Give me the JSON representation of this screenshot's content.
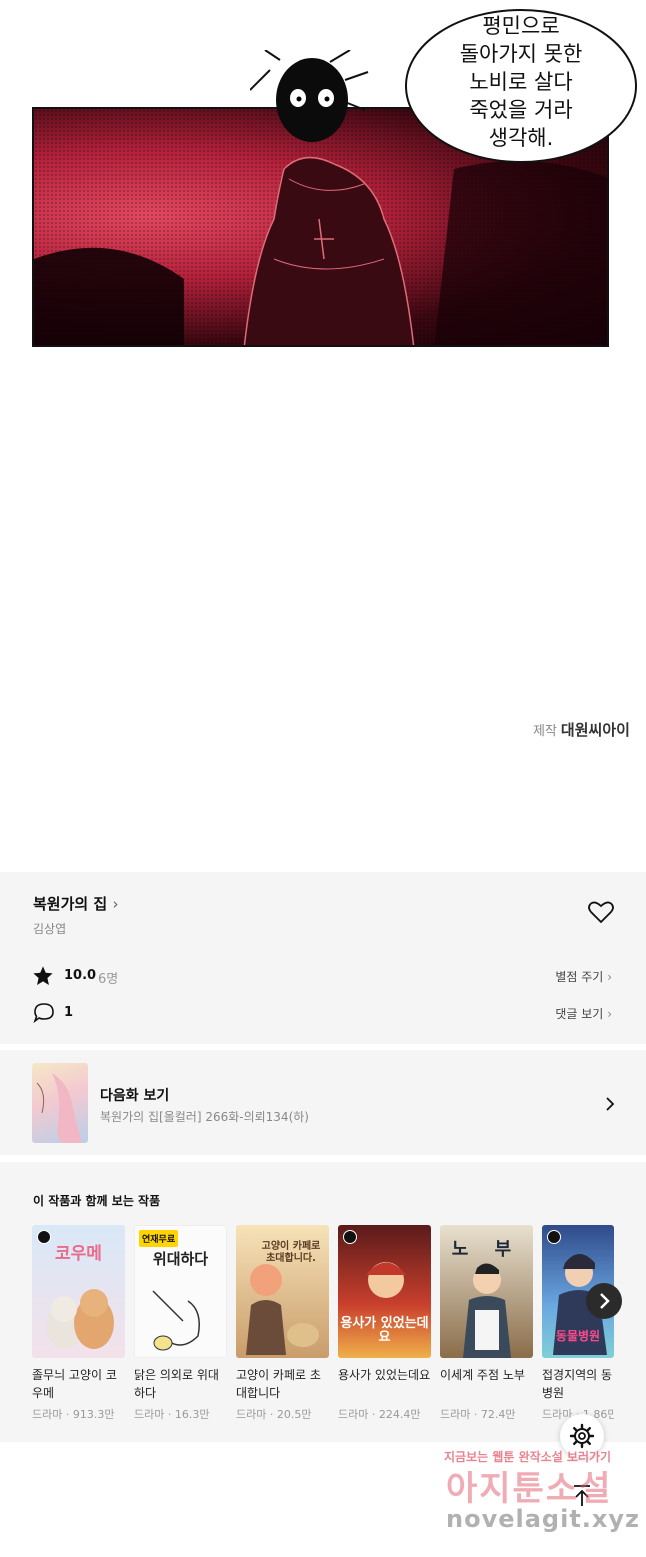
{
  "comic": {
    "speech_lines": [
      "평민으로",
      "돌아가지 못한",
      "노비로 살다",
      "죽었을 거라",
      "생각해."
    ],
    "credit_label": "제작",
    "credit_name": "대원씨아이"
  },
  "series": {
    "title": "복원가의 집",
    "author": "김상엽",
    "rating": "10.0",
    "rating_count": "6명",
    "rate_link": "별점 주기",
    "comment_count": "1",
    "comment_link": "댓글 보기"
  },
  "next_episode": {
    "label": "다음화 보기",
    "subtitle": "복원가의 집[올컬러] 266화-의뢰134(하)"
  },
  "recommendations": {
    "heading": "이 작품과 함께 보는 작품",
    "items": [
      {
        "title": "졸무늬 고양이 코우메",
        "meta": "드라마 · 913.3만",
        "cover_text": "코우메",
        "badge": ""
      },
      {
        "title": "닭은 의외로 위대하다",
        "meta": "드라마 · 16.3만",
        "cover_text": "위대하다",
        "badge": "연재무료"
      },
      {
        "title": "고양이 카페로 초대합니다",
        "meta": "드라마 · 20.5만",
        "cover_text": "고양이 카페로 초대합니다.",
        "badge": ""
      },
      {
        "title": "용사가 있었는데요",
        "meta": "드라마 · 224.4만",
        "cover_text": "용사가 있었는데요",
        "badge": ""
      },
      {
        "title": "이세계 주점 노부",
        "meta": "드라마 · 72.4만",
        "cover_text": "노 부",
        "badge": ""
      },
      {
        "title": "접경지역의 동 병원",
        "meta": "드라마 · 1.86만",
        "cover_text": "동물병원",
        "badge": ""
      }
    ]
  },
  "watermark": {
    "line1": "지금보는 웹툰 완작소설 보러가기",
    "line2": "아지툰소설",
    "line3": "novelagit.xyz"
  },
  "colors": {
    "panel_red": "#c22a44",
    "background_gray": "#f5f5f5",
    "watermark_pink": "#e35b6b"
  }
}
